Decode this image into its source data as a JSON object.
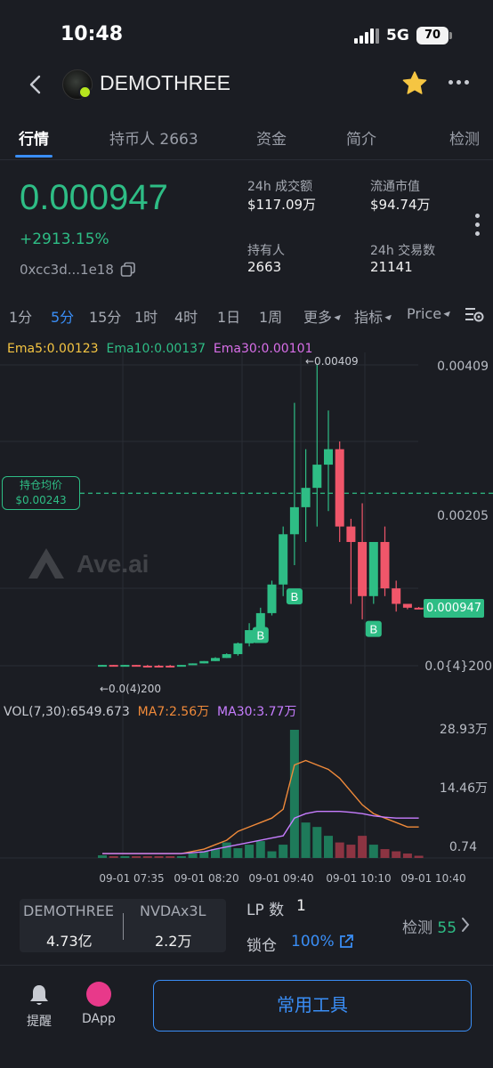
{
  "status": {
    "time": "10:48",
    "network": "5G",
    "battery": "70"
  },
  "header": {
    "title": "DEMOTHREE"
  },
  "tabs": [
    {
      "label": "行情",
      "active": true
    },
    {
      "label": "持币人 2663"
    },
    {
      "label": "资金"
    },
    {
      "label": "简介"
    },
    {
      "label": "检测"
    }
  ],
  "overview": {
    "price": "0.000947",
    "change": "+2913.15%",
    "address": "0xcc3d...1e18",
    "stats": [
      {
        "label": "24h 成交额",
        "value": "$117.09万"
      },
      {
        "label": "流通市值",
        "value": "$94.74万"
      },
      {
        "label": "持有人",
        "value": "2663"
      },
      {
        "label": "24h 交易数",
        "value": "21141"
      }
    ]
  },
  "intervals": [
    {
      "label": "1分"
    },
    {
      "label": "5分",
      "active": true
    },
    {
      "label": "15分"
    },
    {
      "label": "1时"
    },
    {
      "label": "4时"
    },
    {
      "label": "1日"
    },
    {
      "label": "1周"
    },
    {
      "label": "更多"
    },
    {
      "label": "指标"
    },
    {
      "label": "Price"
    }
  ],
  "ema": {
    "ema5": "Ema5:0.00123",
    "ema10": "Ema10:0.00137",
    "ema30": "Ema30:0.00101"
  },
  "chart_labels": {
    "high_marker": "←0.00409",
    "low_marker": "←0.0(4)200",
    "hold_title": "持仓均价",
    "hold_value": "$0.00243",
    "current_price": "0.000947",
    "buy_marker": "B",
    "watermark": "Ave.ai"
  },
  "volume": {
    "vol": "VOL(7,30):6549.673",
    "ma7": "MA7:2.56万",
    "ma30": "MA30:3.77万"
  },
  "colors": {
    "up": "#2ebd85",
    "down": "#f0566a",
    "accent": "#3a8ef6",
    "ema5": "#f5c542",
    "ema10": "#2ebd85",
    "ema30": "#d86ee8",
    "ma7": "#f08a3a",
    "ma30": "#c77dff"
  },
  "chart_data": {
    "type": "candlestick",
    "price_axis": [
      "0.00409",
      "0.00205",
      "0.0{4}200"
    ],
    "volume_axis": [
      "28.93万",
      "14.46万",
      "0.74"
    ],
    "x_ticks": [
      "09-01 07:35",
      "09-01 08:20",
      "09-01 09:40",
      "09-01 10:10",
      "09-01 10:40"
    ],
    "candles": [
      {
        "o": 0.0002,
        "h": 0.00021,
        "l": 0.0002,
        "c": 0.00021,
        "up": true
      },
      {
        "o": 0.00021,
        "h": 0.00021,
        "l": 0.0002,
        "c": 0.0002,
        "up": false
      },
      {
        "o": 0.0002,
        "h": 0.00021,
        "l": 0.0002,
        "c": 0.00021,
        "up": true
      },
      {
        "o": 0.00021,
        "h": 0.00021,
        "l": 0.0002,
        "c": 0.0002,
        "up": false
      },
      {
        "o": 0.0002,
        "h": 0.00021,
        "l": 0.0002,
        "c": 0.0002,
        "up": false
      },
      {
        "o": 0.0002,
        "h": 0.00021,
        "l": 0.0002,
        "c": 0.0002,
        "up": false
      },
      {
        "o": 0.0002,
        "h": 0.00021,
        "l": 0.0002,
        "c": 0.0002,
        "up": false
      },
      {
        "o": 0.0002,
        "h": 0.00021,
        "l": 0.0002,
        "c": 0.00021,
        "up": true
      },
      {
        "o": 0.00021,
        "h": 0.00023,
        "l": 0.00021,
        "c": 0.00023,
        "up": true
      },
      {
        "o": 0.00023,
        "h": 0.00026,
        "l": 0.00023,
        "c": 0.00026,
        "up": true
      },
      {
        "o": 0.00026,
        "h": 0.00031,
        "l": 0.00026,
        "c": 0.0003,
        "up": true
      },
      {
        "o": 0.0003,
        "h": 0.00036,
        "l": 0.0003,
        "c": 0.00035,
        "up": true
      },
      {
        "o": 0.00035,
        "h": 0.0005,
        "l": 0.00033,
        "c": 0.00049,
        "up": true
      },
      {
        "o": 0.00049,
        "h": 0.00075,
        "l": 0.00045,
        "c": 0.00066,
        "up": true
      },
      {
        "o": 0.00066,
        "h": 0.00095,
        "l": 0.0006,
        "c": 0.00088,
        "up": true
      },
      {
        "o": 0.00088,
        "h": 0.0013,
        "l": 0.00085,
        "c": 0.00125,
        "up": true
      },
      {
        "o": 0.00125,
        "h": 0.002,
        "l": 0.0011,
        "c": 0.0019,
        "up": true
      },
      {
        "o": 0.0019,
        "h": 0.0036,
        "l": 0.0015,
        "c": 0.00225,
        "up": true
      },
      {
        "o": 0.00225,
        "h": 0.003,
        "l": 0.0018,
        "c": 0.0025,
        "up": true
      },
      {
        "o": 0.0025,
        "h": 0.00409,
        "l": 0.002,
        "c": 0.0028,
        "up": true
      },
      {
        "o": 0.0028,
        "h": 0.0035,
        "l": 0.0022,
        "c": 0.003,
        "up": true
      },
      {
        "o": 0.003,
        "h": 0.0031,
        "l": 0.0018,
        "c": 0.002,
        "up": false
      },
      {
        "o": 0.002,
        "h": 0.0021,
        "l": 0.001,
        "c": 0.0018,
        "up": false
      },
      {
        "o": 0.0018,
        "h": 0.0023,
        "l": 0.0008,
        "c": 0.0011,
        "up": false
      },
      {
        "o": 0.0011,
        "h": 0.0018,
        "l": 0.001,
        "c": 0.0018,
        "up": true
      },
      {
        "o": 0.0018,
        "h": 0.002,
        "l": 0.0011,
        "c": 0.0012,
        "up": false
      },
      {
        "o": 0.0012,
        "h": 0.0013,
        "l": 0.0009,
        "c": 0.001,
        "up": false
      },
      {
        "o": 0.001,
        "h": 0.001,
        "l": 0.00093,
        "c": 0.00095,
        "up": false
      },
      {
        "o": 0.00095,
        "h": 0.00096,
        "l": 0.00094,
        "c": 0.000947,
        "up": false
      }
    ],
    "volumes": [
      0.6,
      0.3,
      0.3,
      0.3,
      0.2,
      0.2,
      0.2,
      0.4,
      1.0,
      1.5,
      2.0,
      3.5,
      2.2,
      3.0,
      3.8,
      1.5,
      3.0,
      28.93,
      8.0,
      7.0,
      5.0,
      3.5,
      3.0,
      5.0,
      3.0,
      2.0,
      1.5,
      1.0,
      0.5
    ]
  },
  "bottom": {
    "pair1_name": "DEMOTHREE",
    "pair1_value": "4.73亿",
    "pair2_name": "NVDAx3L",
    "pair2_value": "2.2万",
    "lp_label": "LP 数",
    "lp_value": "1",
    "lock_label": "锁仓",
    "lock_value": "100%",
    "check_label": "检测",
    "check_value": "55"
  },
  "footer": {
    "alert_label": "提醒",
    "dapp_label": "DApp",
    "tools_label": "常用工具"
  }
}
